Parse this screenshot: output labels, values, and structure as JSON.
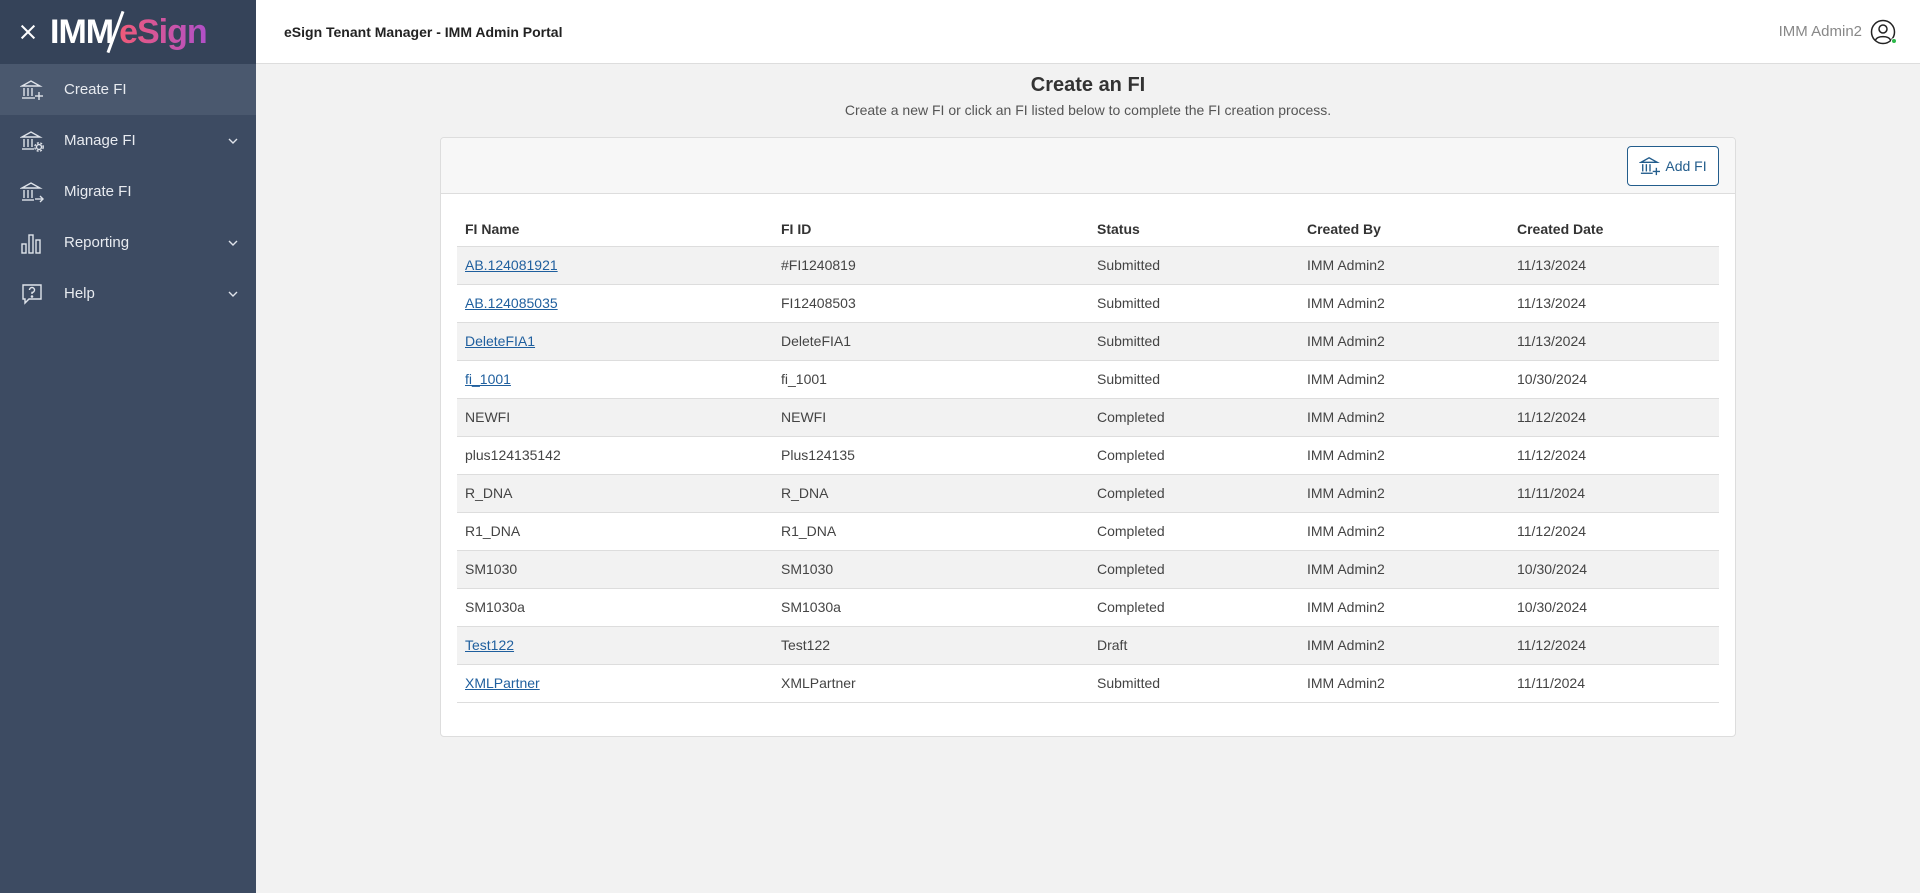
{
  "brand": {
    "logo_left": "IMM",
    "logo_right": "eSign"
  },
  "sidebar": {
    "items": [
      {
        "label": "Create FI",
        "active": true,
        "expandable": false
      },
      {
        "label": "Manage FI",
        "active": false,
        "expandable": true
      },
      {
        "label": "Migrate FI",
        "active": false,
        "expandable": false
      },
      {
        "label": "Reporting",
        "active": false,
        "expandable": true
      },
      {
        "label": "Help",
        "active": false,
        "expandable": true
      }
    ]
  },
  "header": {
    "title": "eSign Tenant Manager - IMM Admin Portal",
    "user": "IMM Admin2"
  },
  "main": {
    "title": "Create an FI",
    "subtitle": "Create a new FI or click an FI listed below to complete the FI creation process.",
    "add_button": "Add FI",
    "columns": [
      "FI Name",
      "FI ID",
      "Status",
      "Created By",
      "Created Date"
    ],
    "rows": [
      {
        "name": "AB.124081921",
        "id": "#FI1240819",
        "status": "Submitted",
        "created_by": "IMM Admin2",
        "date": "11/13/2024",
        "link": true
      },
      {
        "name": "AB.124085035",
        "id": "FI12408503",
        "status": "Submitted",
        "created_by": "IMM Admin2",
        "date": "11/13/2024",
        "link": true
      },
      {
        "name": "DeleteFIA1",
        "id": "DeleteFIA1",
        "status": "Submitted",
        "created_by": "IMM Admin2",
        "date": "11/13/2024",
        "link": true
      },
      {
        "name": "fi_1001",
        "id": "fi_1001",
        "status": "Submitted",
        "created_by": "IMM Admin2",
        "date": "10/30/2024",
        "link": true
      },
      {
        "name": "NEWFI",
        "id": "NEWFI",
        "status": "Completed",
        "created_by": "IMM Admin2",
        "date": "11/12/2024",
        "link": false
      },
      {
        "name": "plus124135142",
        "id": "Plus124135",
        "status": "Completed",
        "created_by": "IMM Admin2",
        "date": "11/12/2024",
        "link": false
      },
      {
        "name": "R_DNA",
        "id": "R_DNA",
        "status": "Completed",
        "created_by": "IMM Admin2",
        "date": "11/11/2024",
        "link": false
      },
      {
        "name": "R1_DNA",
        "id": "R1_DNA",
        "status": "Completed",
        "created_by": "IMM Admin2",
        "date": "11/12/2024",
        "link": false
      },
      {
        "name": "SM1030",
        "id": "SM1030",
        "status": "Completed",
        "created_by": "IMM Admin2",
        "date": "10/30/2024",
        "link": false
      },
      {
        "name": "SM1030a",
        "id": "SM1030a",
        "status": "Completed",
        "created_by": "IMM Admin2",
        "date": "10/30/2024",
        "link": false
      },
      {
        "name": "Test122",
        "id": "Test122",
        "status": "Draft",
        "created_by": "IMM Admin2",
        "date": "11/12/2024",
        "link": true
      },
      {
        "name": "XMLPartner",
        "id": "XMLPartner",
        "status": "Submitted",
        "created_by": "IMM Admin2",
        "date": "11/11/2024",
        "link": true
      }
    ]
  },
  "colors": {
    "sidebar_bg": "#3d4b62",
    "link": "#1f5f9e",
    "accent_button": "#235d8c",
    "status_online": "#2db84a"
  }
}
